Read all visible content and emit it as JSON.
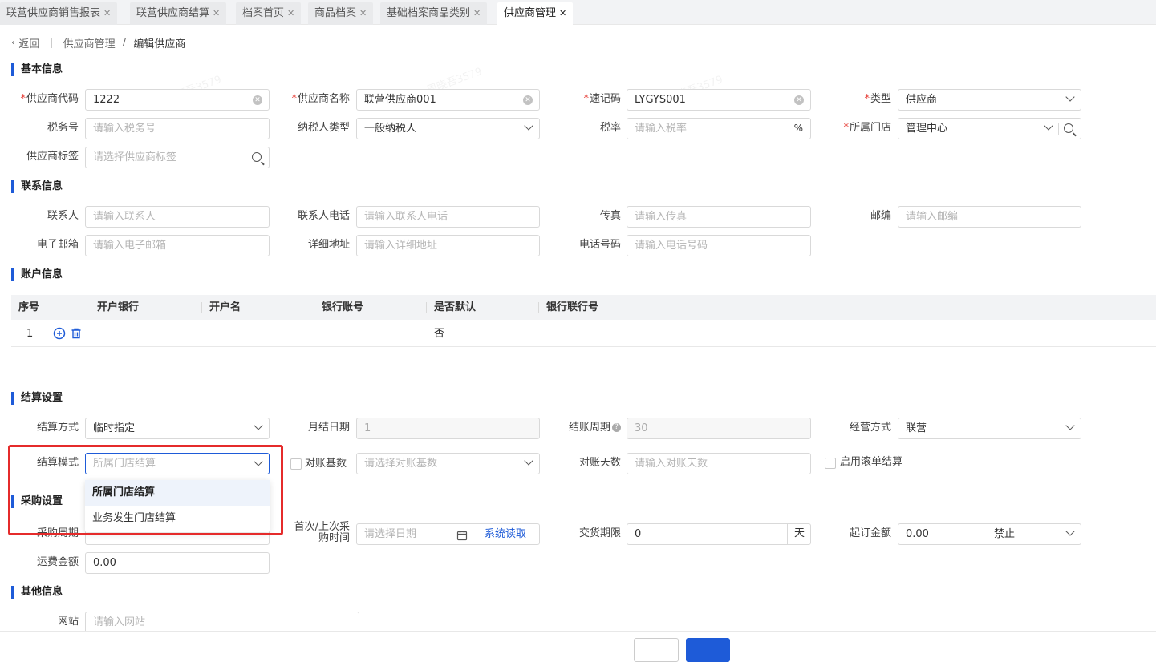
{
  "tabs": [
    {
      "label": "联营供应商销售报表"
    },
    {
      "label": "联营供应商结算"
    },
    {
      "label": "档案首页"
    },
    {
      "label": "商品档案"
    },
    {
      "label": "基础档案商品类别"
    },
    {
      "label": "供应商管理",
      "active": true
    }
  ],
  "breadcrumb": {
    "back": "返回",
    "parent": "供应商管理",
    "separator": "/",
    "current": "编辑供应商"
  },
  "sections": {
    "basic": "基本信息",
    "contact": "联系信息",
    "account": "账户信息",
    "settlement": "结算设置",
    "purchase": "采购设置",
    "other": "其他信息"
  },
  "basic": {
    "code_label": "供应商代码",
    "code_value": "1222",
    "name_label": "供应商名称",
    "name_value": "联营供应商001",
    "mnemonic_label": "速记码",
    "mnemonic_value": "LYGYS001",
    "type_label": "类型",
    "type_value": "供应商",
    "tax_no_label": "税务号",
    "tax_no_placeholder": "请输入税务号",
    "taxpayer_label": "纳税人类型",
    "taxpayer_value": "一般纳税人",
    "tax_rate_label": "税率",
    "tax_rate_placeholder": "请输入税率",
    "tax_rate_unit": "%",
    "store_label": "所属门店",
    "store_value": "管理中心",
    "tag_label": "供应商标签",
    "tag_placeholder": "请选择供应商标签"
  },
  "contact": {
    "person_label": "联系人",
    "person_placeholder": "请输入联系人",
    "phone_label": "联系人电话",
    "phone_placeholder": "请输入联系人电话",
    "fax_label": "传真",
    "fax_placeholder": "请输入传真",
    "zip_label": "邮编",
    "zip_placeholder": "请输入邮编",
    "email_label": "电子邮箱",
    "email_placeholder": "请输入电子邮箱",
    "address_label": "详细地址",
    "address_placeholder": "请输入详细地址",
    "tel_label": "电话号码",
    "tel_placeholder": "请输入电话号码"
  },
  "account_table": {
    "headers": [
      "序号",
      "开户银行",
      "开户名",
      "银行账号",
      "是否默认",
      "银行联行号"
    ],
    "rows": [
      {
        "index": "1",
        "is_default": "否"
      }
    ]
  },
  "settlement": {
    "method_label": "结算方式",
    "method_value": "临时指定",
    "month_day_label": "月结日期",
    "month_day_value": "1",
    "cycle_label": "结账周期",
    "cycle_value": "30",
    "biz_label": "经营方式",
    "biz_value": "联营",
    "mode_label": "结算模式",
    "mode_placeholder": "所属门店结算",
    "base_label": "对账基数",
    "base_placeholder": "请选择对账基数",
    "days_label": "对账天数",
    "days_placeholder": "请输入对账天数",
    "rolling_label": "启用滚单结算",
    "mode_options": [
      "所属门店结算",
      "业务发生门店结算"
    ]
  },
  "purchase": {
    "cycle_label": "采购周期",
    "last_time_label_1": "首次/上次采",
    "last_time_label_2": "购时间",
    "date_placeholder": "请选择日期",
    "read_button": "系统读取",
    "delivery_label": "交货期限",
    "delivery_value": "0",
    "delivery_unit": "天",
    "min_amount_label": "起订金额",
    "min_amount_value": "0.00",
    "min_amount_mode": "禁止",
    "freight_label": "运费金额",
    "freight_value": "0.00"
  },
  "other": {
    "website_label": "网站",
    "website_placeholder": "请输入网站"
  },
  "colors": {
    "accent": "#1e5bd8",
    "required": "#e5342d",
    "highlight": "#e52b2b"
  }
}
